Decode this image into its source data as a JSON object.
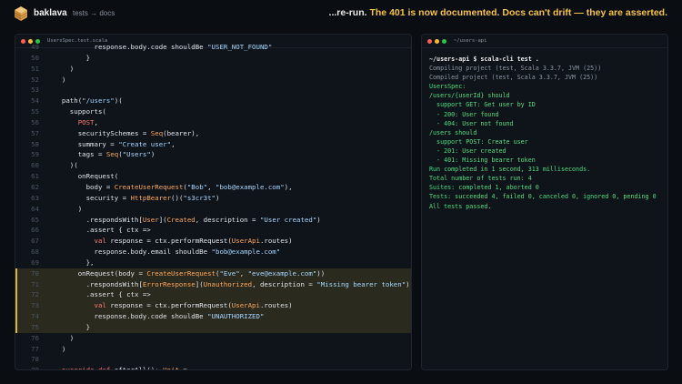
{
  "app": {
    "brand": "baklava",
    "breadcrumb": "tests → docs",
    "headline": [
      {
        "text": "...re-run. ",
        "tone": "w"
      },
      {
        "text": "The 401 is now documented.",
        "tone": "y"
      },
      {
        "text": " Docs can't drift — they are asserted.",
        "tone": "y"
      }
    ]
  },
  "colors": {
    "accent": "#f6c343",
    "string": "#a5d6ff",
    "keyword": "#ff7b72",
    "type": "#ffa657",
    "function": "#d2a8ff",
    "success": "#4ade80",
    "highlight": "#2b2a1e"
  },
  "editor": {
    "filename": "UsersSpec.test.scala",
    "lines": [
      {
        "n": "49",
        "hl": false,
        "tokens": [
          [
            "pl",
            "          response.body.code shouldBe "
          ],
          [
            "str",
            "\"USER_NOT_FOUND\""
          ]
        ]
      },
      {
        "n": "50",
        "hl": false,
        "tokens": [
          [
            "pl",
            "        }"
          ]
        ]
      },
      {
        "n": "51",
        "hl": false,
        "tokens": [
          [
            "pl",
            "    )"
          ]
        ]
      },
      {
        "n": "52",
        "hl": false,
        "tokens": [
          [
            "pl",
            "  )"
          ]
        ]
      },
      {
        "n": "53",
        "hl": false,
        "tokens": []
      },
      {
        "n": "54",
        "hl": false,
        "tokens": [
          [
            "pl",
            "  path("
          ],
          [
            "str",
            "\"/users\""
          ],
          [
            "pl",
            ")("
          ]
        ]
      },
      {
        "n": "55",
        "hl": false,
        "tokens": [
          [
            "pl",
            "    supports("
          ]
        ]
      },
      {
        "n": "56",
        "hl": false,
        "tokens": [
          [
            "pl",
            "      "
          ],
          [
            "kw",
            "POST"
          ],
          [
            "pl",
            ","
          ]
        ]
      },
      {
        "n": "57",
        "hl": false,
        "tokens": [
          [
            "pl",
            "      securitySchemes = "
          ],
          [
            "ty",
            "Seq"
          ],
          [
            "pl",
            "(bearer),"
          ]
        ]
      },
      {
        "n": "58",
        "hl": false,
        "tokens": [
          [
            "pl",
            "      summary = "
          ],
          [
            "str",
            "\"Create user\""
          ],
          [
            "pl",
            ","
          ]
        ]
      },
      {
        "n": "59",
        "hl": false,
        "tokens": [
          [
            "pl",
            "      tags = "
          ],
          [
            "ty",
            "Seq"
          ],
          [
            "pl",
            "("
          ],
          [
            "str",
            "\"Users\""
          ],
          [
            "pl",
            ")"
          ]
        ]
      },
      {
        "n": "60",
        "hl": false,
        "tokens": [
          [
            "pl",
            "    )("
          ]
        ]
      },
      {
        "n": "61",
        "hl": false,
        "tokens": [
          [
            "pl",
            "      onRequest("
          ]
        ]
      },
      {
        "n": "62",
        "hl": false,
        "tokens": [
          [
            "pl",
            "        body = "
          ],
          [
            "ty",
            "CreateUserRequest"
          ],
          [
            "pl",
            "("
          ],
          [
            "str",
            "\"Bob\""
          ],
          [
            "pl",
            ", "
          ],
          [
            "str",
            "\"bob@example.com\""
          ],
          [
            "pl",
            "),"
          ]
        ]
      },
      {
        "n": "63",
        "hl": false,
        "tokens": [
          [
            "pl",
            "        security = "
          ],
          [
            "ty",
            "HttpBearer"
          ],
          [
            "pl",
            "()("
          ],
          [
            "str",
            "\"s3cr3t\""
          ],
          [
            "pl",
            ")"
          ]
        ]
      },
      {
        "n": "64",
        "hl": false,
        "tokens": [
          [
            "pl",
            "      )"
          ]
        ]
      },
      {
        "n": "65",
        "hl": false,
        "tokens": [
          [
            "pl",
            "        .respondsWith["
          ],
          [
            "ty",
            "User"
          ],
          [
            "pl",
            "]("
          ],
          [
            "ty",
            "Created"
          ],
          [
            "pl",
            ", description = "
          ],
          [
            "str",
            "\"User created\""
          ],
          [
            "pl",
            ")"
          ]
        ]
      },
      {
        "n": "66",
        "hl": false,
        "tokens": [
          [
            "pl",
            "        .assert { ctx =>"
          ]
        ]
      },
      {
        "n": "67",
        "hl": false,
        "tokens": [
          [
            "pl",
            "          "
          ],
          [
            "kw",
            "val"
          ],
          [
            "pl",
            " response = ctx.performRequest("
          ],
          [
            "ty",
            "UserApi"
          ],
          [
            "pl",
            ".routes)"
          ]
        ]
      },
      {
        "n": "68",
        "hl": false,
        "tokens": [
          [
            "pl",
            "          response.body.email shouldBe "
          ],
          [
            "str",
            "\"bob@example.com\""
          ]
        ]
      },
      {
        "n": "69",
        "hl": false,
        "tokens": [
          [
            "pl",
            "        },"
          ]
        ]
      },
      {
        "n": "70",
        "hl": true,
        "tokens": [
          [
            "pl",
            "      onRequest(body = "
          ],
          [
            "ty",
            "CreateUserRequest"
          ],
          [
            "pl",
            "("
          ],
          [
            "str",
            "\"Eve\""
          ],
          [
            "pl",
            ", "
          ],
          [
            "str",
            "\"eve@example.com\""
          ],
          [
            "pl",
            "))"
          ]
        ]
      },
      {
        "n": "71",
        "hl": true,
        "tokens": [
          [
            "pl",
            "        .respondsWith["
          ],
          [
            "ty",
            "ErrorResponse"
          ],
          [
            "pl",
            "]("
          ],
          [
            "ty",
            "Unauthorized"
          ],
          [
            "pl",
            ", description = "
          ],
          [
            "str",
            "\"Missing bearer token\""
          ],
          [
            "pl",
            ")"
          ]
        ]
      },
      {
        "n": "72",
        "hl": true,
        "tokens": [
          [
            "pl",
            "        .assert { ctx =>"
          ]
        ]
      },
      {
        "n": "73",
        "hl": true,
        "tokens": [
          [
            "pl",
            "          "
          ],
          [
            "kw",
            "val"
          ],
          [
            "pl",
            " response = ctx.performRequest("
          ],
          [
            "ty",
            "UserApi"
          ],
          [
            "pl",
            ".routes)"
          ]
        ]
      },
      {
        "n": "74",
        "hl": true,
        "tokens": [
          [
            "pl",
            "          response.body.code shouldBe "
          ],
          [
            "str",
            "\"UNAUTHORIZED\""
          ]
        ]
      },
      {
        "n": "75",
        "hl": true,
        "tokens": [
          [
            "pl",
            "        }"
          ]
        ]
      },
      {
        "n": "76",
        "hl": false,
        "tokens": [
          [
            "pl",
            "    )"
          ]
        ]
      },
      {
        "n": "77",
        "hl": false,
        "tokens": [
          [
            "pl",
            "  )"
          ]
        ]
      },
      {
        "n": "78",
        "hl": false,
        "tokens": []
      },
      {
        "n": "79",
        "hl": false,
        "tokens": [
          [
            "kw",
            "  override def"
          ],
          [
            "pl",
            " afterAll(): "
          ],
          [
            "ty",
            "Unit"
          ],
          [
            "pl",
            " ="
          ]
        ]
      }
    ]
  },
  "terminal": {
    "title": "~/users-api",
    "lines": [
      {
        "tone": "cmd",
        "text": "~/users-api $ scala-cli test ."
      },
      {
        "tone": "dim",
        "text": "Compiling project (test, Scala 3.3.7, JVM (25))"
      },
      {
        "tone": "dim",
        "text": "Compiled project (test, Scala 3.3.7, JVM (25))"
      },
      {
        "tone": "grn",
        "text": "UsersSpec:"
      },
      {
        "tone": "grn",
        "text": "/users/{userId} should"
      },
      {
        "tone": "grn",
        "text": "  support GET: Get user by ID"
      },
      {
        "tone": "grn",
        "text": "  - 200: User found"
      },
      {
        "tone": "grn",
        "text": "  - 404: User not found"
      },
      {
        "tone": "grn",
        "text": "/users should"
      },
      {
        "tone": "grn",
        "text": "  support POST: Create user"
      },
      {
        "tone": "grn",
        "text": "  - 201: User created"
      },
      {
        "tone": "grn",
        "text": "  - 401: Missing bearer token"
      },
      {
        "tone": "grn",
        "text": "Run completed in 1 second, 313 milliseconds."
      },
      {
        "tone": "grn",
        "text": "Total number of tests run: 4"
      },
      {
        "tone": "grn",
        "text": "Suites: completed 1, aborted 0"
      },
      {
        "tone": "grn",
        "text": "Tests: succeeded 4, failed 0, canceled 0, ignored 0, pending 0"
      },
      {
        "tone": "grn",
        "text": "All tests passed."
      }
    ]
  }
}
